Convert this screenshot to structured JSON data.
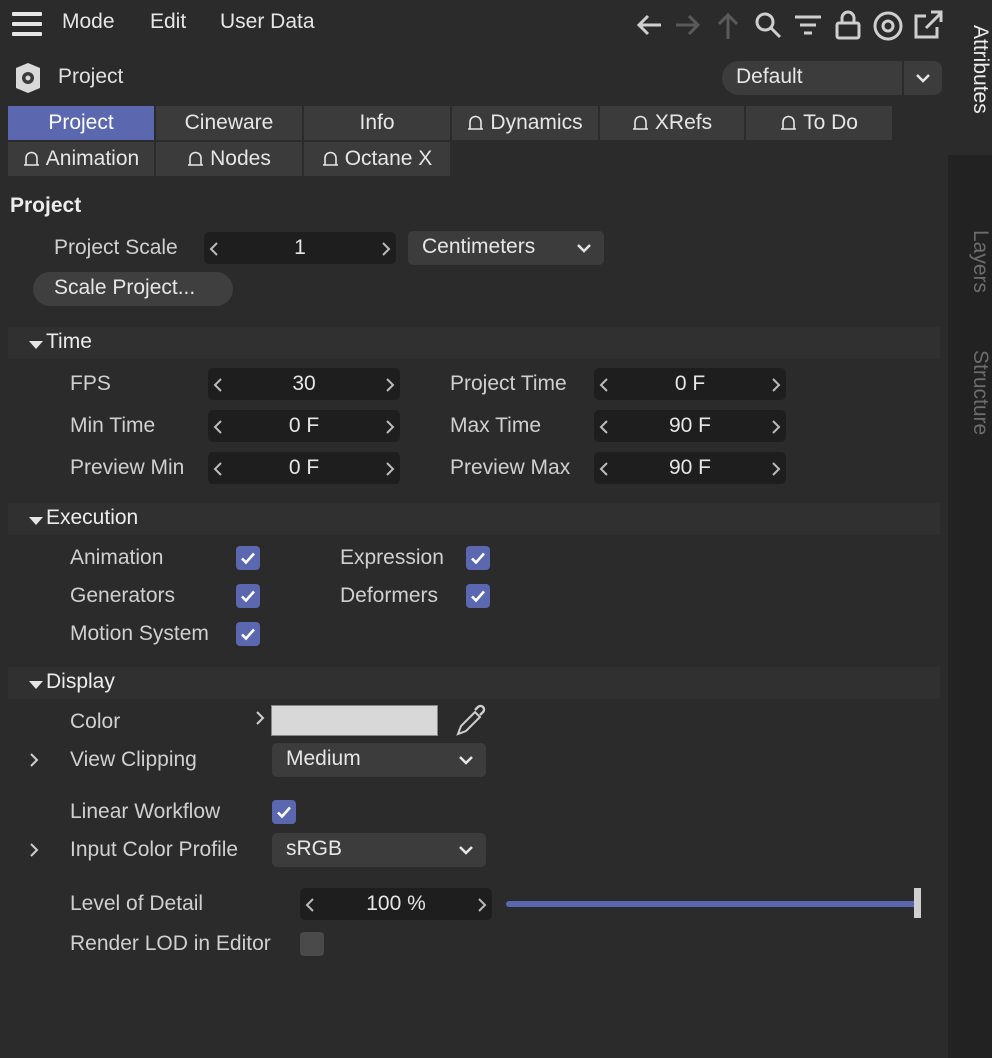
{
  "menu": {
    "mode": "Mode",
    "edit": "Edit",
    "user_data": "User Data"
  },
  "toolbar_icons": [
    "arrow-left-icon",
    "arrow-right-icon",
    "arrow-up-icon",
    "search-icon",
    "filter-icon",
    "lock-icon",
    "target-icon",
    "open-external-icon"
  ],
  "object": {
    "title": "Project",
    "mode_value": "Default"
  },
  "tabs": {
    "row1": [
      {
        "label": "Project"
      },
      {
        "label": "Cineware"
      },
      {
        "label": "Info"
      },
      {
        "label": "Dynamics"
      },
      {
        "label": "XRefs"
      },
      {
        "label": "To Do"
      }
    ],
    "row2": [
      {
        "label": "Animation"
      },
      {
        "label": "Nodes"
      },
      {
        "label": "Octane X"
      }
    ]
  },
  "project_section": {
    "heading": "Project",
    "scale_label": "Project Scale",
    "scale_value": "1",
    "scale_unit": "Centimeters",
    "scale_button": "Scale Project..."
  },
  "time": {
    "title": "Time",
    "fps_label": "FPS",
    "fps": "30",
    "project_time_label": "Project Time",
    "project_time": "0 F",
    "min_time_label": "Min Time",
    "min_time": "0 F",
    "max_time_label": "Max Time",
    "max_time": "90 F",
    "preview_min_label": "Preview Min",
    "preview_min": "0 F",
    "preview_max_label": "Preview Max",
    "preview_max": "90 F"
  },
  "execution": {
    "title": "Execution",
    "animation": "Animation",
    "animation_checked": true,
    "expression": "Expression",
    "expression_checked": true,
    "generators": "Generators",
    "generators_checked": true,
    "deformers": "Deformers",
    "deformers_checked": true,
    "motion_system": "Motion System",
    "motion_system_checked": true
  },
  "display": {
    "title": "Display",
    "color_label": "Color",
    "color_value": "#d8d8d8",
    "view_clipping_label": "View Clipping",
    "view_clipping": "Medium",
    "linear_workflow_label": "Linear Workflow",
    "linear_workflow_checked": true,
    "input_color_profile_label": "Input Color Profile",
    "input_color_profile": "sRGB",
    "lod_label": "Level of Detail",
    "lod_value": "100 %",
    "lod_fraction": 1.0,
    "render_lod_label": "Render LOD in Editor",
    "render_lod_checked": false
  },
  "side_tabs": {
    "attributes": "Attributes",
    "layers": "Layers",
    "structure": "Structure"
  },
  "colors": {
    "accent": "#5b68b0",
    "background": "#2b2b2b",
    "field": "#1e1e1e",
    "side_panel": "#222222"
  }
}
